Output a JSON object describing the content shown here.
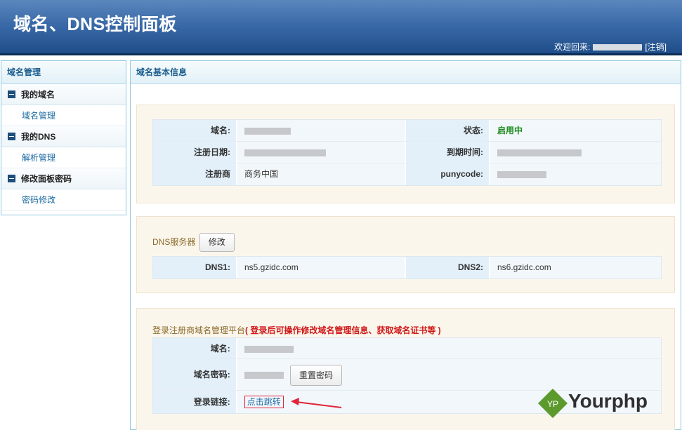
{
  "header": {
    "title": "域名、DNS控制面板",
    "welcome_text": "欢迎回来:",
    "logout": "[注销]"
  },
  "sidebar": {
    "title": "域名管理",
    "groups": [
      {
        "label": "我的域名",
        "items": [
          {
            "label": "域名管理"
          }
        ]
      },
      {
        "label": "我的DNS",
        "items": [
          {
            "label": "解析管理"
          }
        ]
      },
      {
        "label": "修改面板密码",
        "items": [
          {
            "label": "密码修改"
          }
        ]
      }
    ]
  },
  "main": {
    "title": "域名基本信息",
    "basic_info": {
      "domain_label": "域名:",
      "status_label": "状态:",
      "status_value": "启用中",
      "reg_date_label": "注册日期:",
      "expire_label": "到期时间:",
      "registrar_label": "注册商",
      "registrar_value": "商务中国",
      "punycode_label": "punycode:"
    },
    "dns": {
      "section_label": "DNS服务器",
      "modify_button": "修改",
      "dns1_label": "DNS1:",
      "dns1_value": "ns5.gzidc.com",
      "dns2_label": "DNS2:",
      "dns2_value": "ns6.gzidc.com"
    },
    "registrar_login": {
      "section_label": "登录注册商域名管理平台",
      "note": "( 登录后可操作修改域名管理信息、获取域名证书等 )",
      "domain_label": "域名:",
      "password_label": "域名密码:",
      "reset_button": "重置密码",
      "link_label": "登录链接:",
      "link_text": "点击跳转"
    }
  },
  "watermark": {
    "badge": "YP",
    "text": "Yourphp"
  },
  "colors": {
    "header_bg": "#3a6aa8",
    "accent_link": "#1b6aa3",
    "status_green": "#1a8a1a",
    "warning_red": "#d01818"
  }
}
